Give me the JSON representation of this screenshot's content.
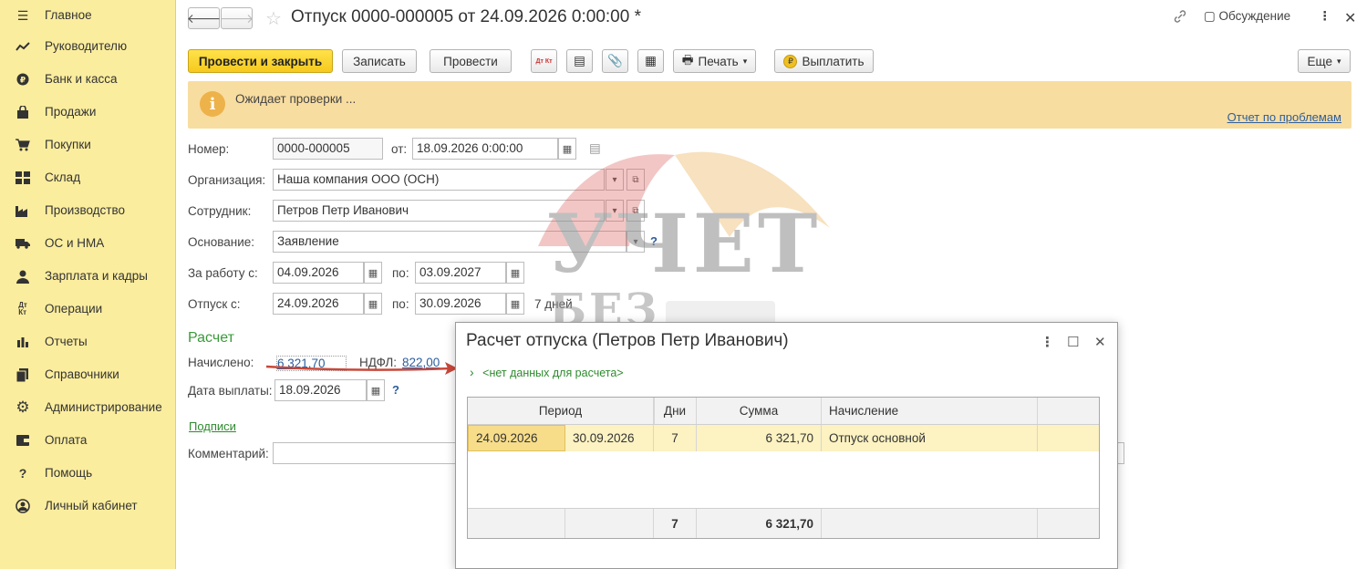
{
  "sidebar": {
    "items": [
      {
        "label": "Главное",
        "icon": "menu-icon"
      },
      {
        "label": "Руководителю",
        "icon": "trend-icon"
      },
      {
        "label": "Банк и касса",
        "icon": "coin-icon"
      },
      {
        "label": "Продажи",
        "icon": "bag-icon"
      },
      {
        "label": "Покупки",
        "icon": "cart-icon"
      },
      {
        "label": "Склад",
        "icon": "warehouse-icon"
      },
      {
        "label": "Производство",
        "icon": "factory-icon"
      },
      {
        "label": "ОС и НМА",
        "icon": "truck-icon"
      },
      {
        "label": "Зарплата и кадры",
        "icon": "person-icon"
      },
      {
        "label": "Операции",
        "icon": "dt-kt-icon"
      },
      {
        "label": "Отчеты",
        "icon": "bar-chart-icon"
      },
      {
        "label": "Справочники",
        "icon": "books-icon"
      },
      {
        "label": "Администрирование",
        "icon": "gear-icon"
      },
      {
        "label": "Оплата",
        "icon": "wallet-icon"
      },
      {
        "label": "Помощь",
        "icon": "question-icon"
      },
      {
        "label": "Личный кабинет",
        "icon": "user-circle-icon"
      }
    ]
  },
  "header": {
    "title": "Отпуск 0000-000005 от 24.09.2026 0:00:00 *",
    "discussion": "Обсуждение"
  },
  "toolbar": {
    "post_close": "Провести и закрыть",
    "save": "Записать",
    "post": "Провести",
    "print": "Печать",
    "pay": "Выплатить",
    "more": "Еще",
    "dt_kt": "Дт Кт"
  },
  "banner": {
    "message": "Ожидает проверки ...",
    "link": "Отчет по проблемам"
  },
  "form": {
    "number_label": "Номер:",
    "number": "0000-000005",
    "from_label": "от:",
    "from": "18.09.2026  0:00:00",
    "org_label": "Организация:",
    "org": "Наша компания ООО (ОСН)",
    "employee_label": "Сотрудник:",
    "employee": "Петров Петр Иванович",
    "basis_label": "Основание:",
    "basis": "Заявление",
    "work_from_label": "За работу с:",
    "work_from": "04.09.2026",
    "work_to_label": "по:",
    "work_to": "03.09.2027",
    "vac_from_label": "Отпуск с:",
    "vac_from": "24.09.2026",
    "vac_to_label": "по:",
    "vac_to": "30.09.2026",
    "days": "7 дней",
    "section": "Расчет",
    "accrued_label": "Начислено:",
    "accrued": "6 321,70",
    "ndfl_label": "НДФЛ:",
    "ndfl": "822,00",
    "pay_date_label": "Дата выплаты:",
    "pay_date": "18.09.2026",
    "signatures": "Подписи",
    "comment_label": "Комментарий:",
    "help": "?"
  },
  "watermark": {
    "line1": "УЧЕТ",
    "line2": "БЕЗ ЗАБОТ"
  },
  "modal": {
    "title": "Расчет отпуска (Петров Петр Иванович)",
    "nodata": "<нет данных для расчета>",
    "columns": [
      "Период",
      "Дни",
      "Сумма",
      "Начисление"
    ],
    "row": {
      "from": "24.09.2026",
      "to": "30.09.2026",
      "days": "7",
      "sum": "6 321,70",
      "type": "Отпуск основной"
    },
    "totals": {
      "days": "7",
      "sum": "6 321,70"
    }
  },
  "colors": {
    "sidebar_bg": "#fbed9e",
    "primary_btn": "#f6c91d",
    "banner_bg": "#f8dda0",
    "section_green": "#3a9a3a",
    "link_blue": "#2c5e9e",
    "row_highlight": "#fcf2c2",
    "arrow_red": "#c8483a"
  }
}
